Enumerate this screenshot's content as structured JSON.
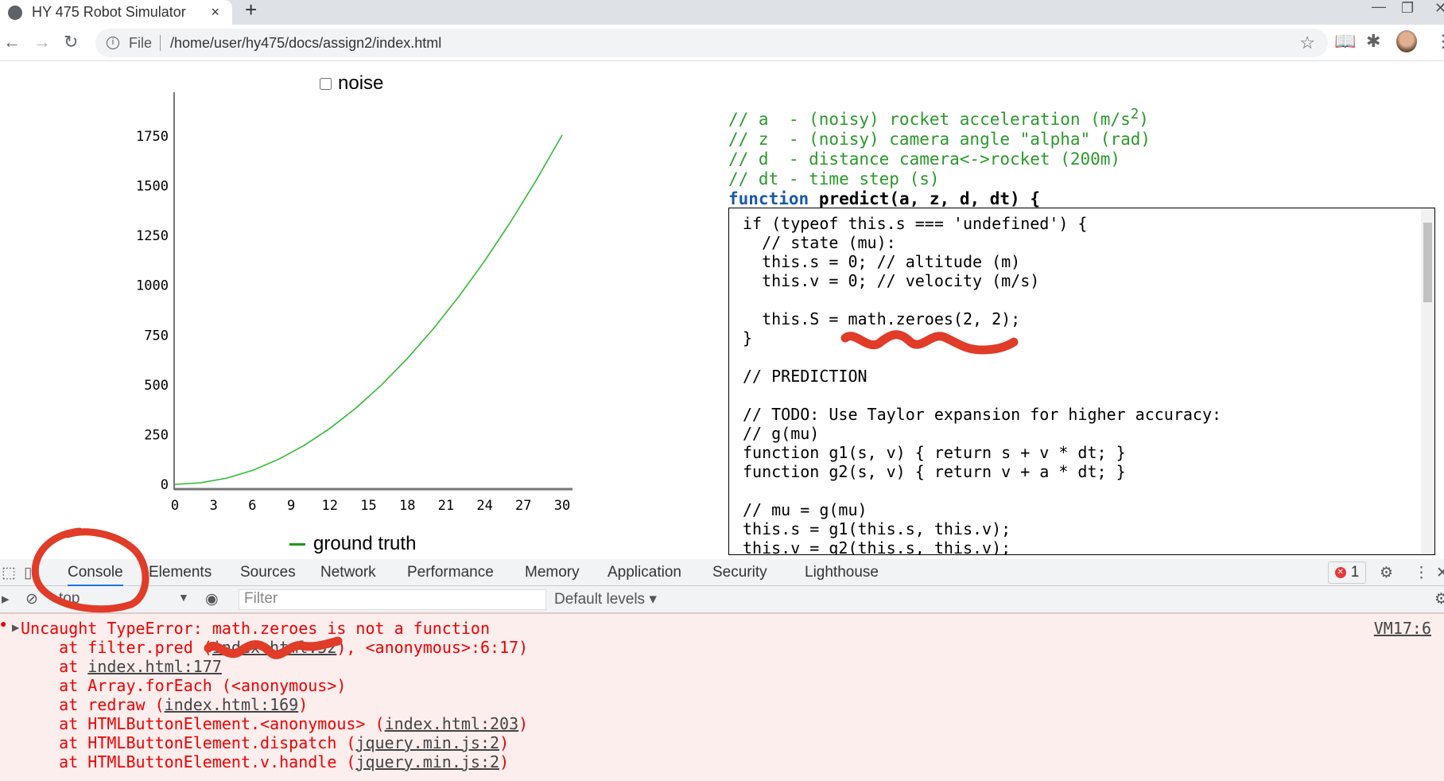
{
  "browser": {
    "tab_title": "HY 475 Robot Simulator",
    "close_tab": "×",
    "new_tab": "+",
    "address_scheme": "File",
    "address_url": "/home/user/hy475/docs/assign2/index.html"
  },
  "page": {
    "noise_label": "noise",
    "noise_checked": false,
    "legend": [
      "ground truth"
    ],
    "comments": [
      "// a  - (noisy) rocket acceleration (m/s",
      "// z  - (noisy) camera angle \"alpha\" (rad)",
      "// d  - distance camera<->rocket (200m)",
      "// dt - time step (s)"
    ],
    "superscript": "2",
    "comment_close": ")",
    "signature_keyword": "function",
    "signature": "predict(a, z, d, dt) {",
    "code": "if (typeof this.s === 'undefined') {\n  // state (mu):\n  this.s = 0; // altitude (m)\n  this.v = 0; // velocity (m/s)\n\n  this.S = math.zeroes(2, 2);\n}\n\n// PREDICTION\n\n// TODO: Use Taylor expansion for higher accuracy:\n// g(mu)\nfunction g1(s, v) { return s + v * dt; }\nfunction g2(s, v) { return v + a * dt; }\n\n// mu = g(mu)\nthis.s = g1(this.s, this.v);\nthis.v = g2(this.s, this.v);"
  },
  "chart_data": {
    "type": "line",
    "xlim": [
      0,
      30
    ],
    "ylim": [
      0,
      1750
    ],
    "xticks": [
      "0",
      "3",
      "6",
      "9",
      "12",
      "15",
      "18",
      "21",
      "24",
      "27",
      "30"
    ],
    "yticks": [
      "0",
      "250",
      "500",
      "750",
      "1000",
      "1250",
      "1500",
      "1750"
    ],
    "series": [
      {
        "name": "ground truth",
        "color": "#33bb33",
        "x": [
          0,
          2,
          4,
          6,
          8,
          10,
          12,
          14,
          16,
          18,
          20,
          22,
          24,
          26,
          28,
          30
        ],
        "y": [
          0,
          8,
          31,
          70,
          125,
          195,
          281,
          382,
          499,
          632,
          780,
          944,
          1123,
          1318,
          1529,
          1755
        ]
      }
    ]
  },
  "devtools": {
    "tabs": [
      "Console",
      "Elements",
      "Sources",
      "Network",
      "Performance",
      "Memory",
      "Application",
      "Security",
      "Lighthouse"
    ],
    "active_tab": "Console",
    "context": "top",
    "filter_placeholder": "Filter",
    "levels": "Default levels ▾",
    "error_count": "1",
    "error_source": "VM17:6",
    "error": {
      "message": "Uncaught TypeError: math.zeroes is not a function",
      "stack": [
        [
          "    at filter.pred (",
          "",
          "index.html:52",
          "), <anonymous>:6:17)"
        ],
        [
          "    at ",
          "",
          "index.html:177",
          ""
        ],
        [
          "    at Array.forEach (<anonymous>)",
          "",
          "",
          ""
        ],
        [
          "    at redraw (",
          "",
          "index.html:169",
          ")"
        ],
        [
          "    at HTMLButtonElement.<anonymous> (",
          "",
          "index.html:203",
          ")"
        ],
        [
          "    at HTMLButtonElement.dispatch (",
          "",
          "jquery.min.js:2",
          ")"
        ],
        [
          "    at HTMLButtonElement.v.handle (",
          "",
          "jquery.min.js:2",
          ")"
        ]
      ]
    }
  },
  "colors": {
    "annotation": "#e03c28",
    "error_bg": "#fdeeee",
    "comment": "#2a9a2a",
    "keyword": "#1a5aa8"
  }
}
